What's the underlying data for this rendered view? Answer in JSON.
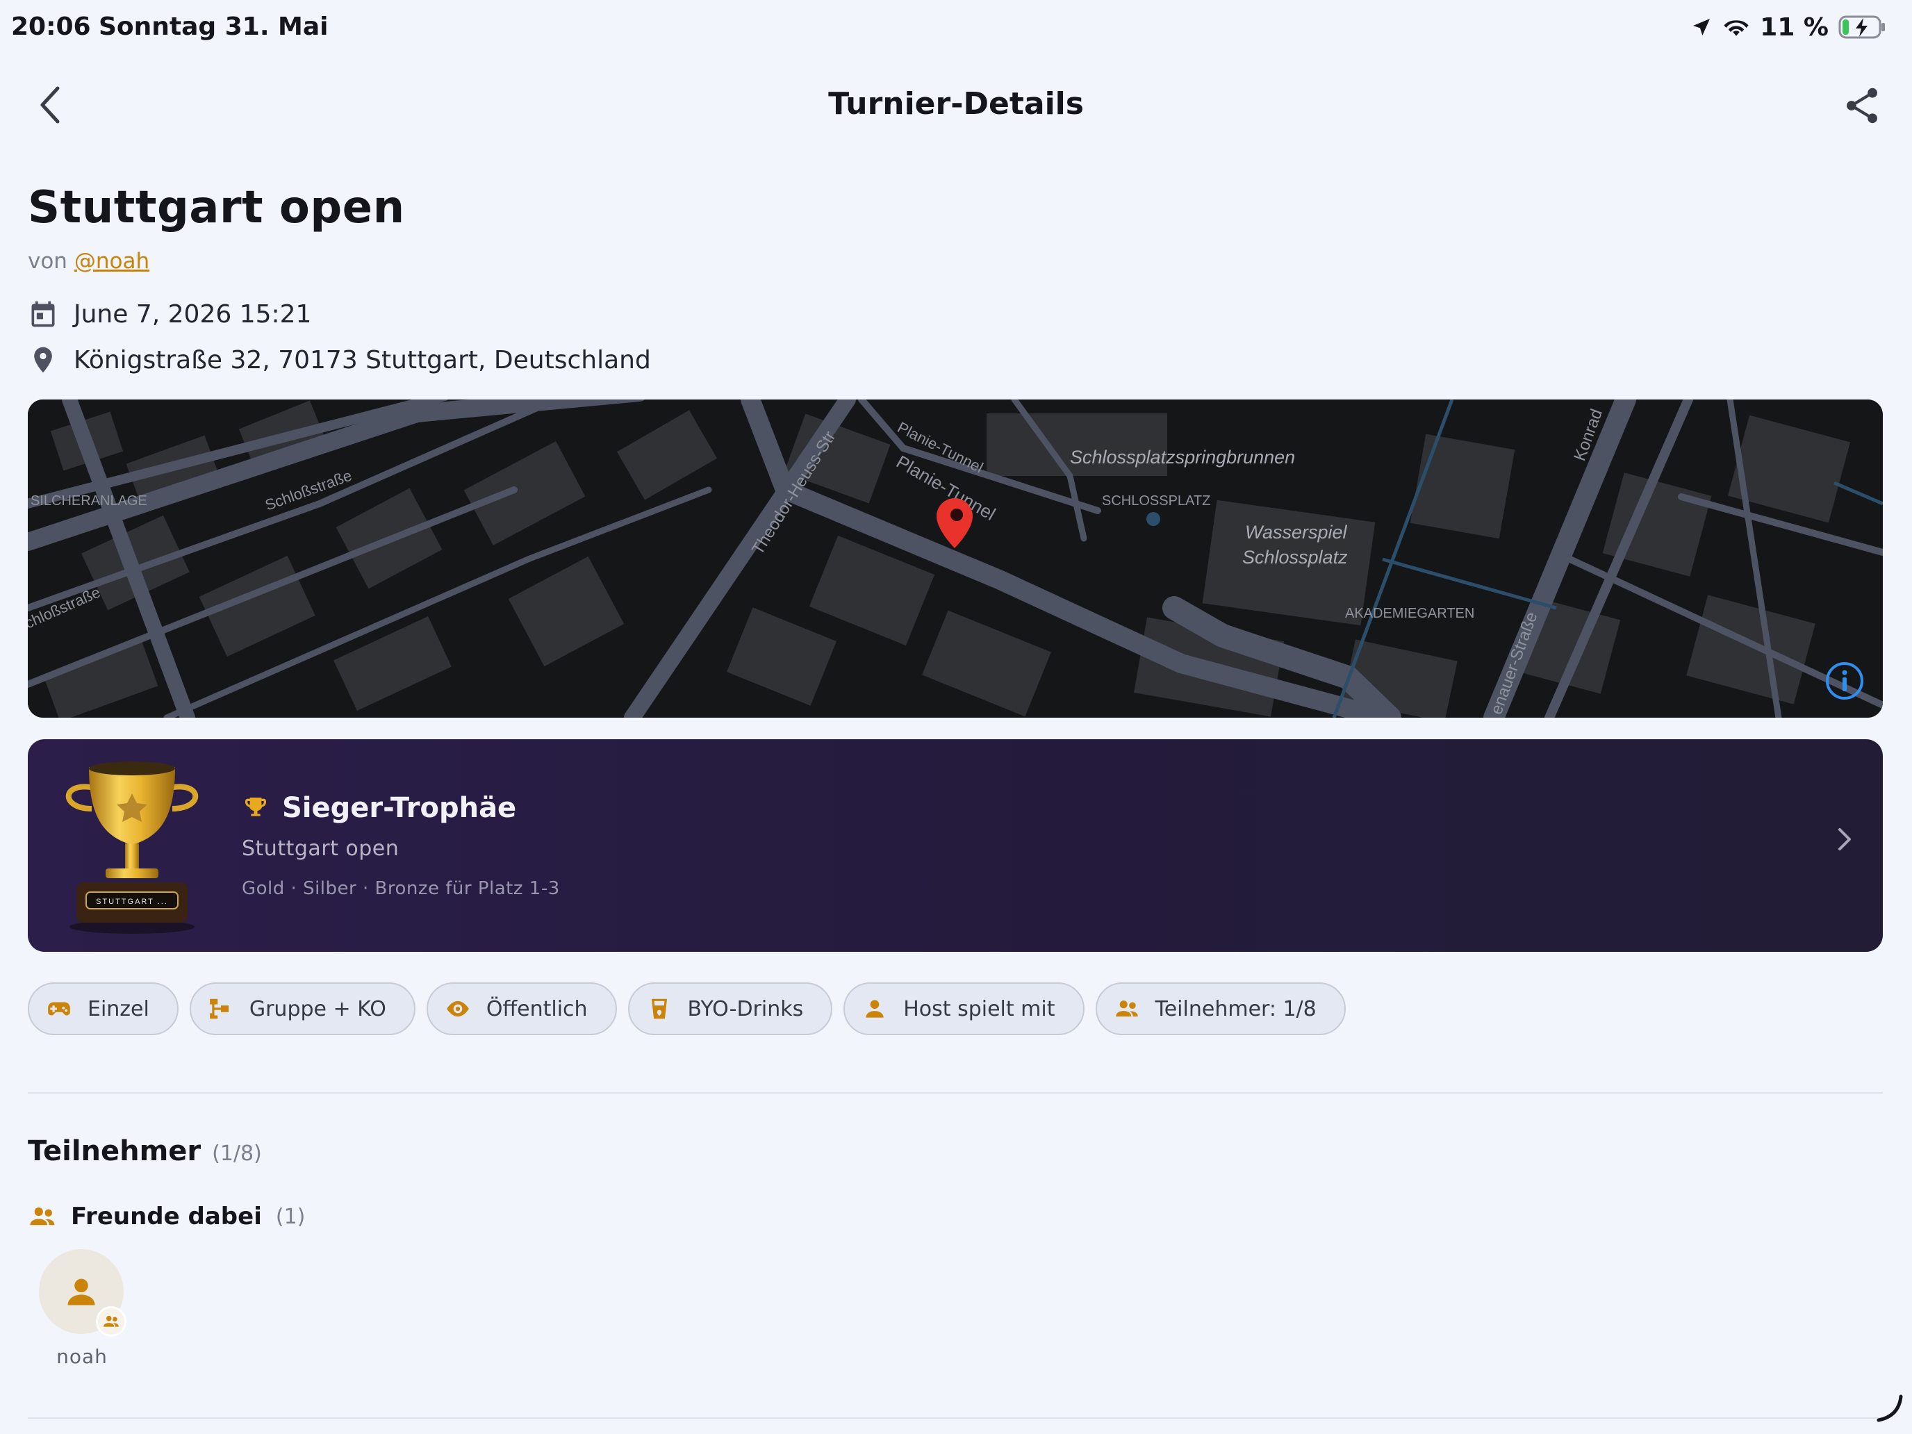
{
  "status_bar": {
    "time": "20:06",
    "date": "Sonntag 31. Mai",
    "battery": "11 %"
  },
  "nav": {
    "title": "Turnier-Details"
  },
  "tournament": {
    "name": "Stuttgart open",
    "by_prefix": "von",
    "host": "@noah",
    "datetime": "June 7, 2026 15:21",
    "address": "Königstraße 32, 70173 Stuttgart, Deutschland"
  },
  "map": {
    "labels": {
      "silcheranlage": "SILCHERANLAGE",
      "schlossstrasse_1": "Schloßstraße",
      "schlossstrasse_2": "chloßstraße",
      "theodor": "Theodor-Heuss-Str",
      "planie_tunnel_1": "Planie-Tunnel",
      "planie_tunnel_2": "Planie-Tunnel",
      "springbrunnen": "Schlossplatzspringbrunnen",
      "schlossplatz": "SCHLOSSPLATZ",
      "wasserspiel_1": "Wasserspiel",
      "wasserspiel_2": "Schlossplatz",
      "akademiegarten": "AKADEMIEGARTEN",
      "adenauer": "enauer-Straße",
      "konrad": "Konrad"
    }
  },
  "trophy": {
    "title": "Sieger-Trophäe",
    "subtitle": "Stuttgart open",
    "description": "Gold · Silber · Bronze für Platz 1-3",
    "plate": "STUTTGART ..."
  },
  "chips": [
    {
      "label": "Einzel",
      "icon": "gamepad-icon"
    },
    {
      "label": "Gruppe + KO",
      "icon": "bracket-icon"
    },
    {
      "label": "Öffentlich",
      "icon": "eye-icon"
    },
    {
      "label": "BYO-Drinks",
      "icon": "drink-icon"
    },
    {
      "label": "Host spielt mit",
      "icon": "person-icon"
    },
    {
      "label": "Teilnehmer: 1/8",
      "icon": "group-icon"
    }
  ],
  "participants_section": {
    "title": "Teilnehmer",
    "count": "(1/8)",
    "friends_title": "Freunde dabei",
    "friends_count": "(1)",
    "participants": [
      {
        "name": "noah"
      }
    ]
  },
  "colors": {
    "accent": "#c98409",
    "background": "#f2f5fc",
    "card": "#2b1e4a",
    "map_bg": "#151618",
    "map_road": "#4d5363",
    "pin": "#e8322b",
    "info_blue": "#2f8ff0"
  }
}
